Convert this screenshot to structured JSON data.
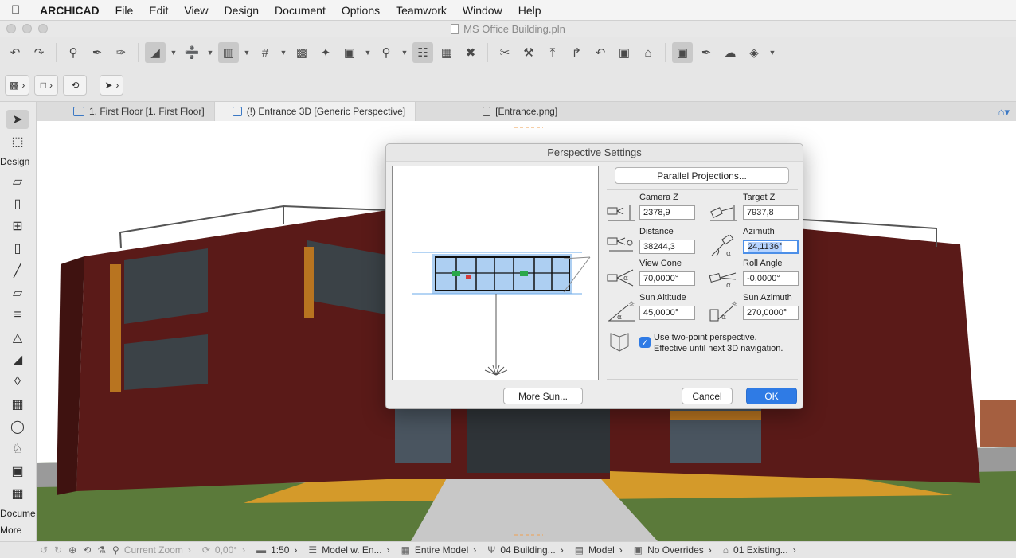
{
  "menubar": {
    "app": "ARCHICAD",
    "items": [
      "File",
      "Edit",
      "View",
      "Design",
      "Document",
      "Options",
      "Teamwork",
      "Window",
      "Help"
    ]
  },
  "window": {
    "title": "MS Office Building.pln"
  },
  "toolbox": {
    "design_label": "Design",
    "document_label": "Docume",
    "more_label": "More"
  },
  "tabs": [
    {
      "label": "1. First Floor [1. First Floor]"
    },
    {
      "label": "(!) Entrance 3D [Generic Perspective]"
    },
    {
      "label": "[Entrance.png]"
    }
  ],
  "dialog": {
    "title": "Perspective Settings",
    "parallel_button": "Parallel Projections...",
    "fields": {
      "camera_z": {
        "label": "Camera Z",
        "value": "2378,9"
      },
      "target_z": {
        "label": "Target Z",
        "value": "7937,8"
      },
      "distance": {
        "label": "Distance",
        "value": "38244,3"
      },
      "azimuth": {
        "label": "Azimuth",
        "value": "24,1136°"
      },
      "view_cone": {
        "label": "View Cone",
        "value": "70,0000°"
      },
      "roll_angle": {
        "label": "Roll Angle",
        "value": "-0,0000°"
      },
      "sun_altitude": {
        "label": "Sun Altitude",
        "value": "45,0000°"
      },
      "sun_azimuth": {
        "label": "Sun Azimuth",
        "value": "270,0000°"
      }
    },
    "two_point": {
      "line1": "Use two-point perspective.",
      "line2": "Effective until next 3D navigation.",
      "checked": true
    },
    "more_sun": "More Sun...",
    "cancel": "Cancel",
    "ok": "OK"
  },
  "statusbar": {
    "zoom": "Current Zoom",
    "angle": "0,00°",
    "scale": "1:50",
    "model_view": "Model w. En...",
    "partial": "Entire Model",
    "layer": "04 Building...",
    "display": "Model",
    "overrides": "No Overrides",
    "renovation": "01 Existing..."
  },
  "colors": {
    "accent": "#2f7be5",
    "brick": "#5a1a18",
    "timber": "#b87420",
    "grass": "#5b7a3a"
  }
}
